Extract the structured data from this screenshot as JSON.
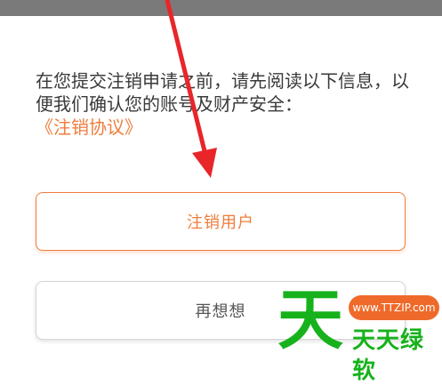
{
  "notice": {
    "text": "在您提交注销申请之前，请先阅读以下信息，以便我们确认您的账号及财产安全：",
    "agreement_link": "《注销协议》"
  },
  "buttons": {
    "deregister_label": "注销用户",
    "reconsider_label": "再想想"
  },
  "watermark": {
    "big_char": "天",
    "url": "www.TTZIP.com",
    "brand": "天天绿软"
  },
  "colors": {
    "accent": "#ef7d3c",
    "annotation_arrow": "#e8262a",
    "watermark_green": "#17b21b",
    "watermark_pill": "#ef6a2a"
  }
}
